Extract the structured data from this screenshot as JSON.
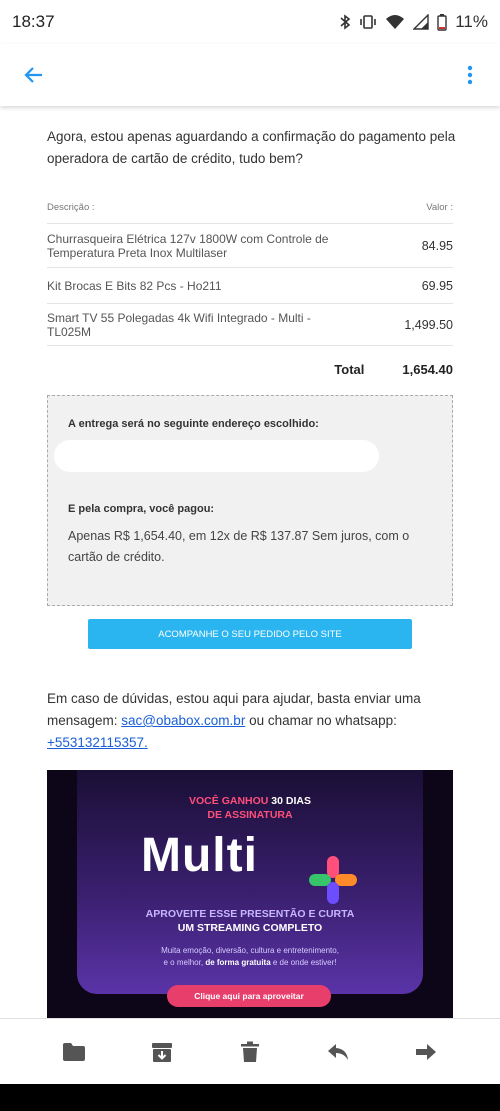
{
  "status_bar": {
    "time": "18:37",
    "battery": "11%"
  },
  "app_bar": {
    "back_icon": "arrow-back-icon",
    "more_icon": "more-vert-icon"
  },
  "email": {
    "intro": "Agora, estou apenas aguardando a confirmação do pagamento pela operadora de cartão de crédito, tudo bem?",
    "table": {
      "header_desc": "Descrição :",
      "header_value": "Valor :",
      "items": [
        {
          "desc": "Churrasqueira Elétrica 127v 1800W com Controle de Temperatura Preta Inox Multilaser",
          "value": "84.95"
        },
        {
          "desc": "Kit Brocas E Bits 82 Pcs - Ho211",
          "value": "69.95"
        },
        {
          "desc": "Smart TV 55 Polegadas 4k Wifi Integrado - Multi - TL025M",
          "value": "1,499.50"
        }
      ],
      "total_label": "Total",
      "total_value": "1,654.40"
    },
    "delivery": {
      "title": "A entrega será no seguinte endereço escolhido:",
      "paid_title": "E pela compra, você pagou:",
      "paid_text": "Apenas R$   1,654.40, em  12x de R$ 137.87   Sem juros, com o cartão de crédito."
    },
    "track_button": "ACOMPANHE O SEU PEDIDO PELO SITE",
    "help": {
      "before": "Em caso de dúvidas, estou aqui para ajudar, basta enviar uma mensagem: ",
      "email": "sac@obabox.com.br",
      "middle": " ou chamar no whatsapp: ",
      "phone": "+553132115357."
    },
    "banner": {
      "line1_a": "VOCÊ GANHOU ",
      "line1_b": "30 DIAS",
      "line2": "DE ASSINATURA",
      "logo": "Multi",
      "sub1": "APROVEITE ESSE PRESENTÃO E CURTA",
      "sub2": "UM STREAMING COMPLETO",
      "small1": "Muita emoção, diversão, cultura e entretenimento,",
      "small2_a": "e o melhor, ",
      "small2_b": "de forma gratuita",
      "small2_c": " e de onde estiver!",
      "cta": "Clique aqui para aproveitar"
    }
  },
  "bottom_bar": {
    "icons": [
      "folder-icon",
      "archive-icon",
      "delete-icon",
      "reply-icon",
      "forward-icon"
    ]
  },
  "colors": {
    "accent": "#2196f3",
    "button": "#2bb5f0",
    "banner_pink": "#e83e6c"
  }
}
